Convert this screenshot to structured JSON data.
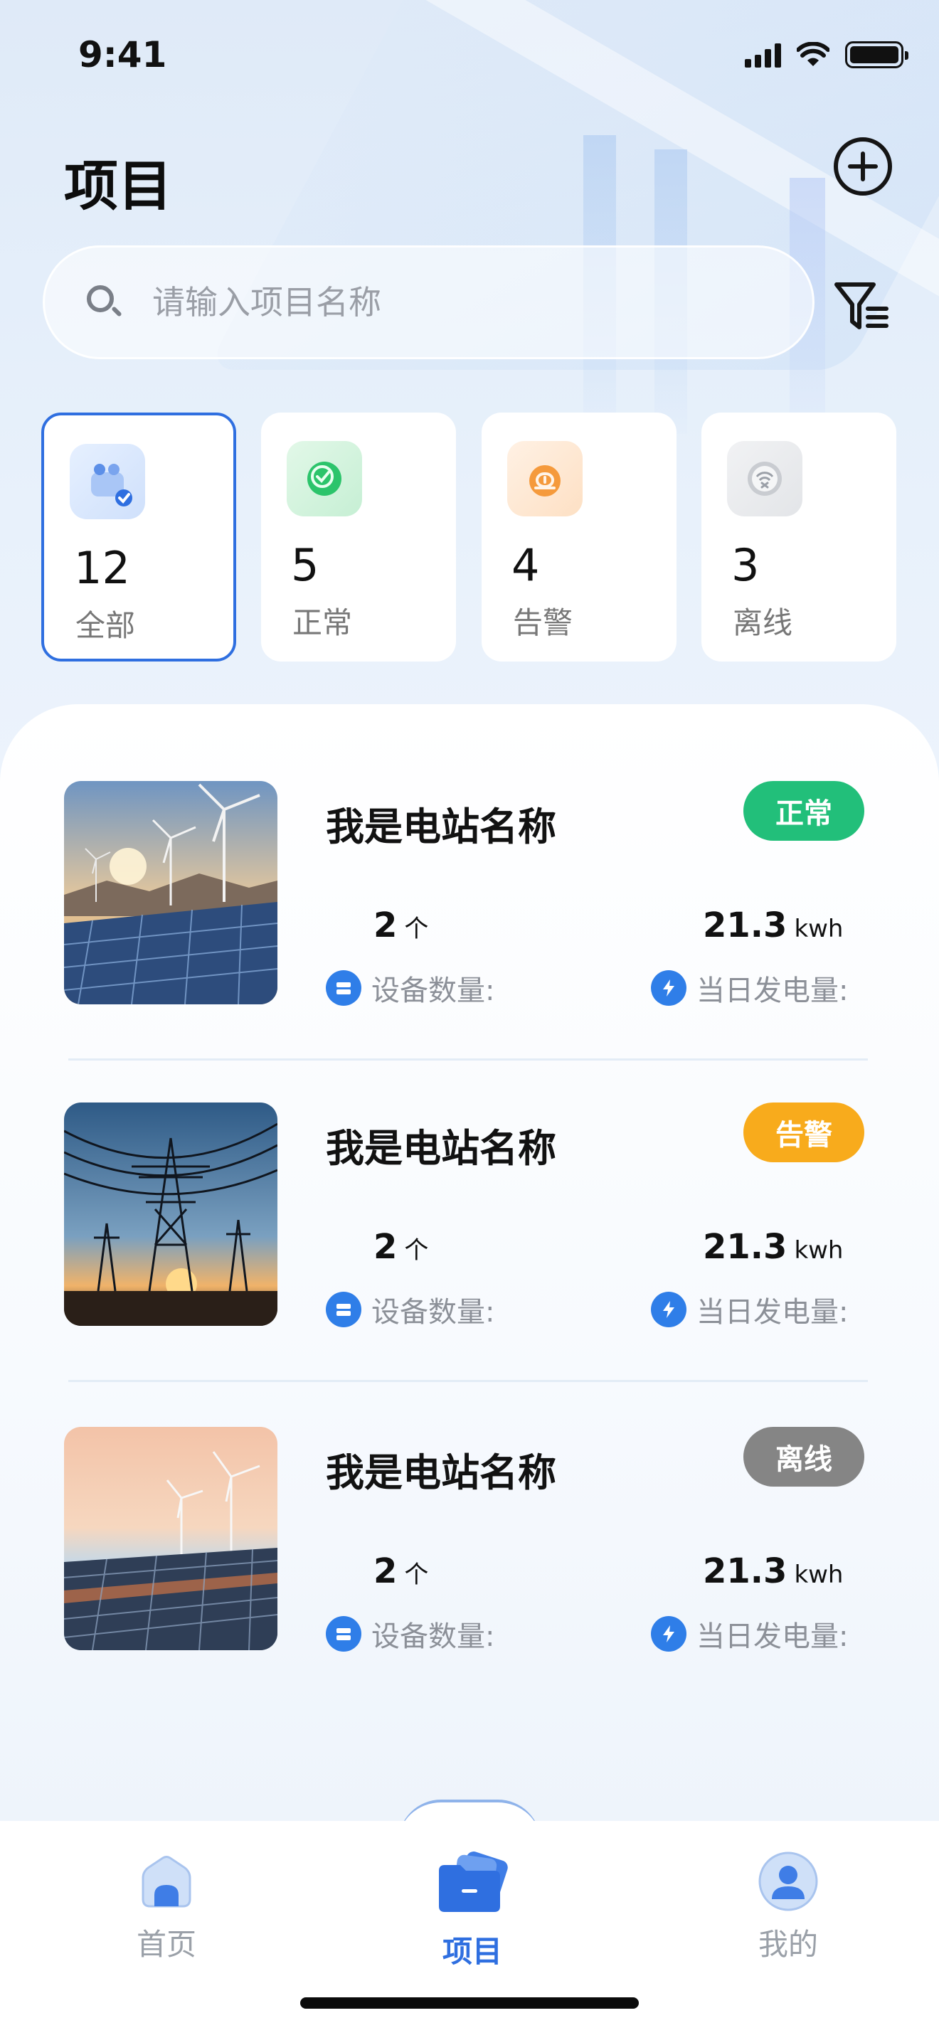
{
  "status_bar": {
    "time": "9:41"
  },
  "header": {
    "title": "项目"
  },
  "search": {
    "placeholder": "请输入项目名称"
  },
  "stats": [
    {
      "count": "12",
      "label": "全部",
      "icon": "all-projects-icon",
      "selected": true
    },
    {
      "count": "5",
      "label": "正常",
      "icon": "check-circle-icon",
      "selected": false
    },
    {
      "count": "4",
      "label": "告警",
      "icon": "alarm-icon",
      "selected": false
    },
    {
      "count": "3",
      "label": "离线",
      "icon": "wifi-off-icon",
      "selected": false
    }
  ],
  "stations": [
    {
      "name": "我是电站名称",
      "status": "正常",
      "status_color": "#22bf7a",
      "image": "wind-solar-photo",
      "device_count": "2",
      "device_unit": "个",
      "device_label": "设备数量:",
      "power_value": "21.3",
      "power_unit": "kwh",
      "power_label": "当日发电量:"
    },
    {
      "name": "我是电站名称",
      "status": "告警",
      "status_color": "#f8ab1c",
      "image": "power-tower-photo",
      "device_count": "2",
      "device_unit": "个",
      "device_label": "设备数量:",
      "power_value": "21.3",
      "power_unit": "kwh",
      "power_label": "当日发电量:"
    },
    {
      "name": "我是电站名称",
      "status": "离线",
      "status_color": "#858585",
      "image": "solar-farm-sunset-photo",
      "device_count": "2",
      "device_unit": "个",
      "device_label": "设备数量:",
      "power_value": "21.3",
      "power_unit": "kwh",
      "power_label": "当日发电量:"
    }
  ],
  "tabs": [
    {
      "label": "首页",
      "icon": "home-icon",
      "active": false
    },
    {
      "label": "项目",
      "icon": "folder-icon",
      "active": true
    },
    {
      "label": "我的",
      "icon": "user-icon",
      "active": false
    }
  ],
  "colors": {
    "accent": "#2f6fe0",
    "tab_active": "#2f6fe0",
    "tab_inactive": "#9aa0a8"
  }
}
